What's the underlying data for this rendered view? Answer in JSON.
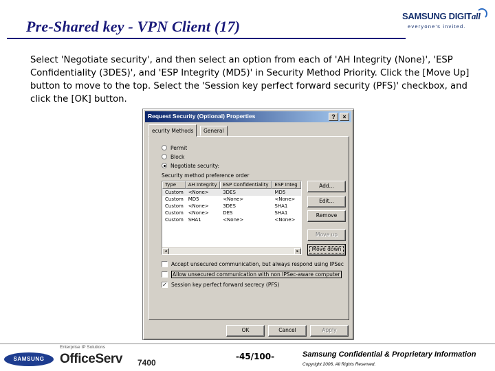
{
  "slide": {
    "title": "Pre-Shared key - VPN Client (17)",
    "instructions": "Select 'Negotiate security', and then select an option from each of 'AH Integrity (None)', 'ESP Confidentiality (3DES)', and 'ESP Integrity (MD5)' in Security Method Priority. Click the [Move Up] button to move to the top. Select the 'Session key perfect forward security (PFS)' checkbox, and click the [OK] button."
  },
  "brand": {
    "word": "SAMSUNG DIGIT",
    "word_suffix": "all",
    "tagline": "everyone's invited."
  },
  "dialog": {
    "title": "Request Security (Optional) Properties",
    "help_glyph": "?",
    "close_glyph": "×",
    "tabs": [
      {
        "label": "ecurity Methods",
        "active": true
      },
      {
        "label": "General",
        "active": false
      }
    ],
    "radios": [
      {
        "label": "Permit",
        "checked": false
      },
      {
        "label": "Block",
        "checked": false
      },
      {
        "label": "Negotiate security:",
        "checked": true
      }
    ],
    "list_label": "Security method preference order",
    "columns": [
      "Type",
      "AH Integrity",
      "ESP Confidentiality",
      "ESP Integ"
    ],
    "rows": [
      [
        "Custom",
        "<None>",
        "3DES",
        "MD5"
      ],
      [
        "Custom",
        "MD5",
        "<None>",
        "<None>"
      ],
      [
        "Custom",
        "<None>",
        "3DES",
        "SHA1"
      ],
      [
        "Custom",
        "<None>",
        "DES",
        "SHA1"
      ],
      [
        "Custom",
        "SHA1",
        "<None>",
        "<None>"
      ]
    ],
    "scroll_left": "◂",
    "scroll_right": "▸",
    "side_buttons": [
      {
        "label": "Add...",
        "disabled": false,
        "focused": false
      },
      {
        "label": "Edit...",
        "disabled": false,
        "focused": false
      },
      {
        "label": "Remove",
        "disabled": false,
        "focused": false
      },
      {
        "label": "Move up",
        "disabled": true,
        "focused": false
      },
      {
        "label": "Move down",
        "disabled": false,
        "focused": true
      }
    ],
    "checkboxes": [
      {
        "label": "Accept unsecured communication, but always respond using IPSec",
        "checked": false
      },
      {
        "label": "Allow unsecured communication with non IPSec-aware computer",
        "checked": false
      },
      {
        "label": "Session key perfect forward secrecy (PFS)",
        "checked": true
      }
    ],
    "footer_buttons": [
      {
        "label": "OK",
        "disabled": false
      },
      {
        "label": "Cancel",
        "disabled": false
      },
      {
        "label": "Apply",
        "disabled": true
      }
    ],
    "check_glyph": "✓"
  },
  "footer": {
    "samsung_logo": "SAMSUNG",
    "officeserv_tagline": "Enterprise IP Solutions",
    "officeserv_name": "OfficeServ",
    "officeserv_model": "7400",
    "page_number": "-45/100-",
    "confidential": "Samsung Confidential & Proprietary Information",
    "copyright": "Copyright 2006, All Rights Reserved."
  },
  "colors": {
    "title_blue": "#1a1a7a",
    "titlebar_start": "#0a246a",
    "titlebar_end": "#a6caf0",
    "dialog_face": "#d4d0c8",
    "samsung_blue": "#1d3c8f"
  }
}
